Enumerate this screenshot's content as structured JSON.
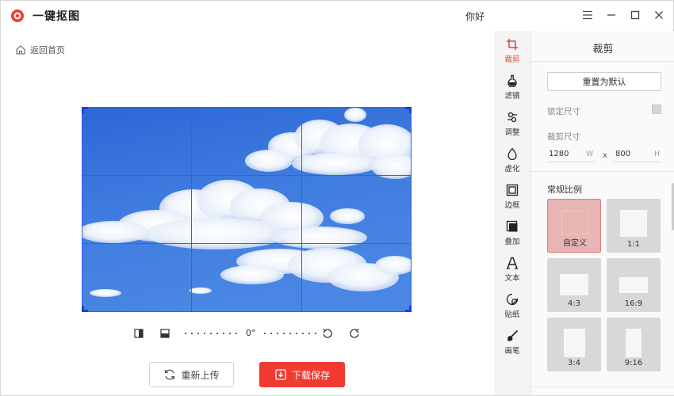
{
  "app": {
    "title": "一键抠图",
    "user_greeting": "你好",
    "accent_color": "#f03a32"
  },
  "window_controls": [
    {
      "name": "menu-icon"
    },
    {
      "name": "minimize-icon"
    },
    {
      "name": "maximize-icon"
    },
    {
      "name": "close-icon"
    }
  ],
  "nav": {
    "back_label": "返回首页"
  },
  "canvas": {
    "rotation_value": "0°",
    "grid": "3x3"
  },
  "actions": {
    "reupload_label": "重新上传",
    "save_label": "下载保存"
  },
  "tools": [
    {
      "id": "crop",
      "label": "裁剪",
      "icon": "crop-icon",
      "active": true
    },
    {
      "id": "filter",
      "label": "滤镜",
      "icon": "flask-icon",
      "active": false
    },
    {
      "id": "adjust",
      "label": "调整",
      "icon": "adjust-icon",
      "active": false
    },
    {
      "id": "blur",
      "label": "虚化",
      "icon": "drop-icon",
      "active": false
    },
    {
      "id": "border",
      "label": "边框",
      "icon": "frame-icon",
      "active": false
    },
    {
      "id": "overlay",
      "label": "叠加",
      "icon": "overlay-icon",
      "active": false
    },
    {
      "id": "text",
      "label": "文本",
      "icon": "text-icon",
      "active": false
    },
    {
      "id": "sticker",
      "label": "贴纸",
      "icon": "sticker-icon",
      "active": false
    },
    {
      "id": "brush",
      "label": "画笔",
      "icon": "brush-icon",
      "active": false
    }
  ],
  "panel": {
    "title": "裁剪",
    "reset_label": "重置为默认",
    "lock_label": "锁定尺寸",
    "size_label": "裁剪尺寸",
    "width_value": "1280",
    "width_unit": "W",
    "height_value": "800",
    "height_unit": "H",
    "separator": "x",
    "ratio_title": "常规比例",
    "ratios": [
      {
        "label": "自定义",
        "active": true
      },
      {
        "label": "1:1",
        "active": false
      },
      {
        "label": "4:3",
        "active": false
      },
      {
        "label": "16:9",
        "active": false
      },
      {
        "label": "3:4",
        "active": false
      },
      {
        "label": "9:16",
        "active": false
      }
    ]
  }
}
